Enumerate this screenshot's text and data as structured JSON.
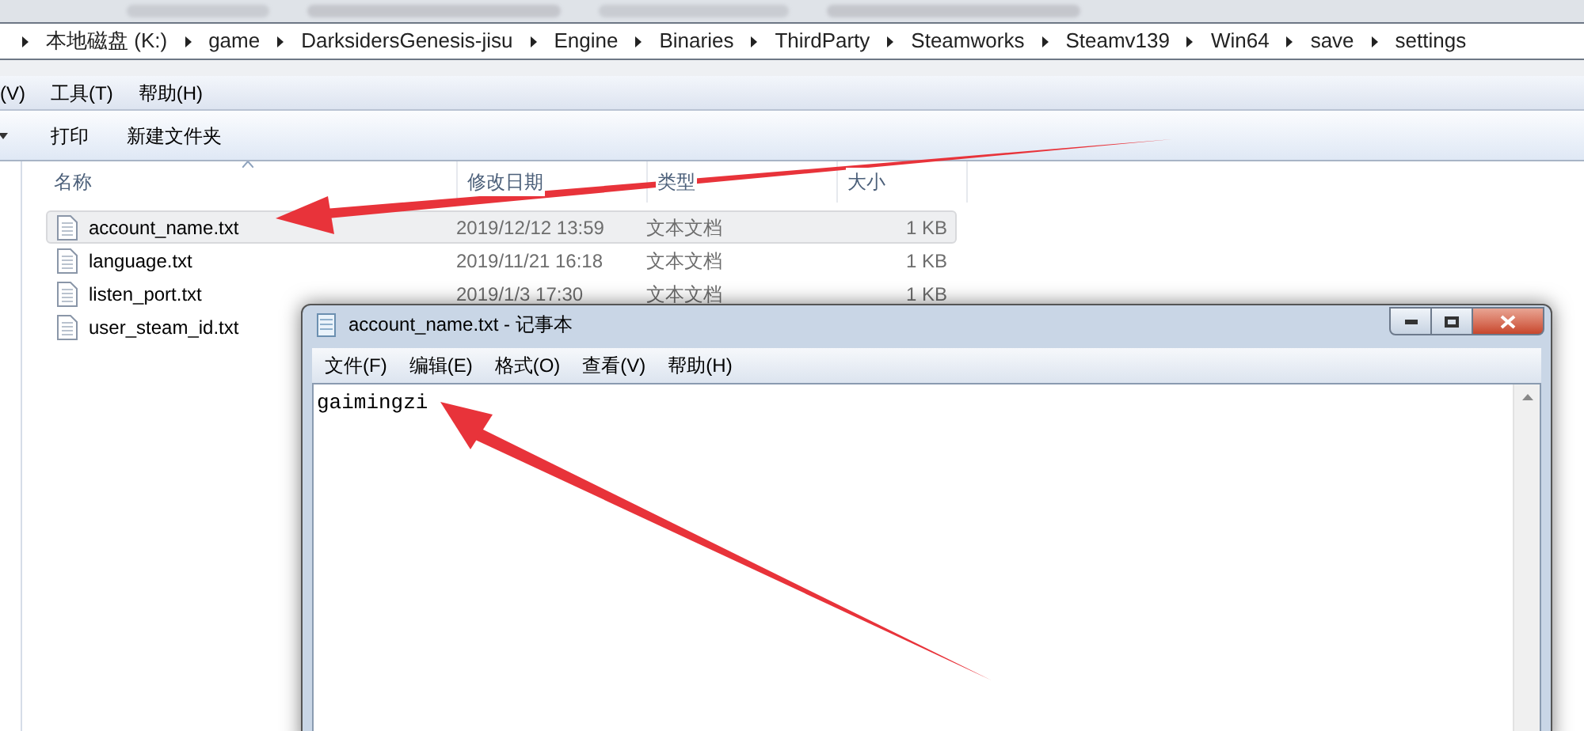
{
  "breadcrumb": [
    "本地磁盘 (K:)",
    "game",
    "DarksidersGenesis-jisu",
    "Engine",
    "Binaries",
    "ThirdParty",
    "Steamworks",
    "Steamv139",
    "Win64",
    "save",
    "settings"
  ],
  "menu": [
    "(V)",
    "工具(T)",
    "帮助(H)"
  ],
  "toolbar": [
    "打印",
    "新建文件夹"
  ],
  "columns": [
    "名称",
    "修改日期",
    "类型",
    "大小"
  ],
  "files": [
    {
      "name": "account_name.txt",
      "date": "2019/12/12 13:59",
      "type": "文本文档",
      "size": "1 KB",
      "selected": true
    },
    {
      "name": "language.txt",
      "date": "2019/11/21 16:18",
      "type": "文本文档",
      "size": "1 KB",
      "selected": false
    },
    {
      "name": "listen_port.txt",
      "date": "2019/1/3 17:30",
      "type": "文本文档",
      "size": "1 KB",
      "selected": false
    },
    {
      "name": "user_steam_id.txt",
      "selected": false
    }
  ],
  "notepad": {
    "title": "account_name.txt - 记事本",
    "menu": [
      "文件(F)",
      "编辑(E)",
      "格式(O)",
      "查看(V)",
      "帮助(H)"
    ],
    "text": "gaimingzi"
  }
}
